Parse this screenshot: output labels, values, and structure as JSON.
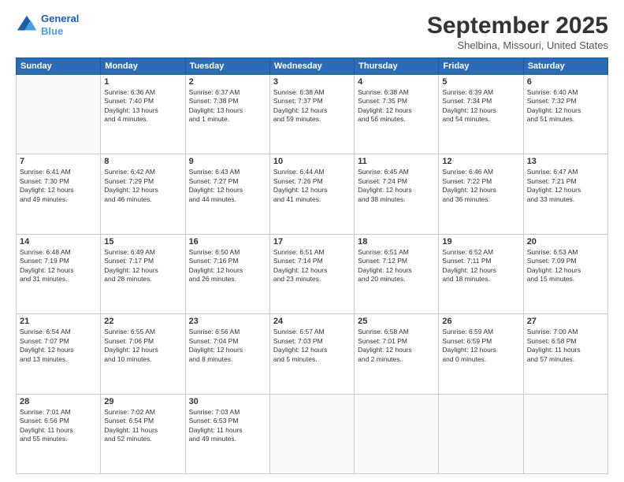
{
  "header": {
    "logo_line1": "General",
    "logo_line2": "Blue",
    "title": "September 2025",
    "subtitle": "Shelbina, Missouri, United States"
  },
  "weekdays": [
    "Sunday",
    "Monday",
    "Tuesday",
    "Wednesday",
    "Thursday",
    "Friday",
    "Saturday"
  ],
  "weeks": [
    [
      {
        "day": "",
        "info": ""
      },
      {
        "day": "1",
        "info": "Sunrise: 6:36 AM\nSunset: 7:40 PM\nDaylight: 13 hours\nand 4 minutes."
      },
      {
        "day": "2",
        "info": "Sunrise: 6:37 AM\nSunset: 7:38 PM\nDaylight: 13 hours\nand 1 minute."
      },
      {
        "day": "3",
        "info": "Sunrise: 6:38 AM\nSunset: 7:37 PM\nDaylight: 12 hours\nand 59 minutes."
      },
      {
        "day": "4",
        "info": "Sunrise: 6:38 AM\nSunset: 7:35 PM\nDaylight: 12 hours\nand 56 minutes."
      },
      {
        "day": "5",
        "info": "Sunrise: 6:39 AM\nSunset: 7:34 PM\nDaylight: 12 hours\nand 54 minutes."
      },
      {
        "day": "6",
        "info": "Sunrise: 6:40 AM\nSunset: 7:32 PM\nDaylight: 12 hours\nand 51 minutes."
      }
    ],
    [
      {
        "day": "7",
        "info": "Sunrise: 6:41 AM\nSunset: 7:30 PM\nDaylight: 12 hours\nand 49 minutes."
      },
      {
        "day": "8",
        "info": "Sunrise: 6:42 AM\nSunset: 7:29 PM\nDaylight: 12 hours\nand 46 minutes."
      },
      {
        "day": "9",
        "info": "Sunrise: 6:43 AM\nSunset: 7:27 PM\nDaylight: 12 hours\nand 44 minutes."
      },
      {
        "day": "10",
        "info": "Sunrise: 6:44 AM\nSunset: 7:26 PM\nDaylight: 12 hours\nand 41 minutes."
      },
      {
        "day": "11",
        "info": "Sunrise: 6:45 AM\nSunset: 7:24 PM\nDaylight: 12 hours\nand 38 minutes."
      },
      {
        "day": "12",
        "info": "Sunrise: 6:46 AM\nSunset: 7:22 PM\nDaylight: 12 hours\nand 36 minutes."
      },
      {
        "day": "13",
        "info": "Sunrise: 6:47 AM\nSunset: 7:21 PM\nDaylight: 12 hours\nand 33 minutes."
      }
    ],
    [
      {
        "day": "14",
        "info": "Sunrise: 6:48 AM\nSunset: 7:19 PM\nDaylight: 12 hours\nand 31 minutes."
      },
      {
        "day": "15",
        "info": "Sunrise: 6:49 AM\nSunset: 7:17 PM\nDaylight: 12 hours\nand 28 minutes."
      },
      {
        "day": "16",
        "info": "Sunrise: 6:50 AM\nSunset: 7:16 PM\nDaylight: 12 hours\nand 26 minutes."
      },
      {
        "day": "17",
        "info": "Sunrise: 6:51 AM\nSunset: 7:14 PM\nDaylight: 12 hours\nand 23 minutes."
      },
      {
        "day": "18",
        "info": "Sunrise: 6:51 AM\nSunset: 7:12 PM\nDaylight: 12 hours\nand 20 minutes."
      },
      {
        "day": "19",
        "info": "Sunrise: 6:52 AM\nSunset: 7:11 PM\nDaylight: 12 hours\nand 18 minutes."
      },
      {
        "day": "20",
        "info": "Sunrise: 6:53 AM\nSunset: 7:09 PM\nDaylight: 12 hours\nand 15 minutes."
      }
    ],
    [
      {
        "day": "21",
        "info": "Sunrise: 6:54 AM\nSunset: 7:07 PM\nDaylight: 12 hours\nand 13 minutes."
      },
      {
        "day": "22",
        "info": "Sunrise: 6:55 AM\nSunset: 7:06 PM\nDaylight: 12 hours\nand 10 minutes."
      },
      {
        "day": "23",
        "info": "Sunrise: 6:56 AM\nSunset: 7:04 PM\nDaylight: 12 hours\nand 8 minutes."
      },
      {
        "day": "24",
        "info": "Sunrise: 6:57 AM\nSunset: 7:03 PM\nDaylight: 12 hours\nand 5 minutes."
      },
      {
        "day": "25",
        "info": "Sunrise: 6:58 AM\nSunset: 7:01 PM\nDaylight: 12 hours\nand 2 minutes."
      },
      {
        "day": "26",
        "info": "Sunrise: 6:59 AM\nSunset: 6:59 PM\nDaylight: 12 hours\nand 0 minutes."
      },
      {
        "day": "27",
        "info": "Sunrise: 7:00 AM\nSunset: 6:58 PM\nDaylight: 11 hours\nand 57 minutes."
      }
    ],
    [
      {
        "day": "28",
        "info": "Sunrise: 7:01 AM\nSunset: 6:56 PM\nDaylight: 11 hours\nand 55 minutes."
      },
      {
        "day": "29",
        "info": "Sunrise: 7:02 AM\nSunset: 6:54 PM\nDaylight: 11 hours\nand 52 minutes."
      },
      {
        "day": "30",
        "info": "Sunrise: 7:03 AM\nSunset: 6:53 PM\nDaylight: 11 hours\nand 49 minutes."
      },
      {
        "day": "",
        "info": ""
      },
      {
        "day": "",
        "info": ""
      },
      {
        "day": "",
        "info": ""
      },
      {
        "day": "",
        "info": ""
      }
    ]
  ]
}
